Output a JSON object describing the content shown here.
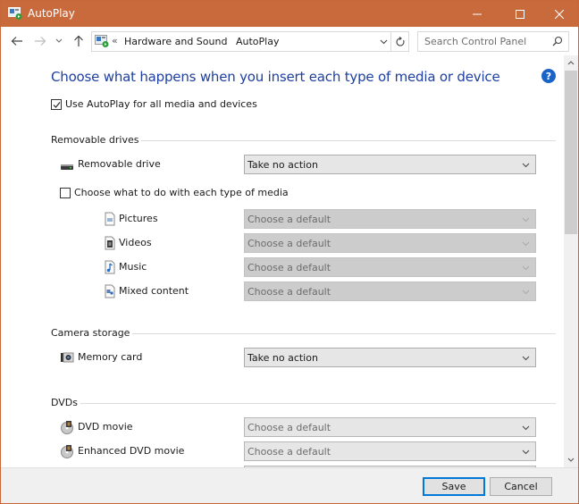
{
  "window": {
    "title": "AutoPlay",
    "accent_color": "#c96a3d"
  },
  "nav": {
    "back_icon": "arrow-left-icon",
    "forward_icon": "arrow-right-icon",
    "recent_icon": "chevron-down-icon",
    "up_icon": "arrow-up-icon",
    "breadcrumb_overflow": "«",
    "breadcrumb": [
      "Hardware and Sound",
      "AutoPlay"
    ],
    "breadcrumb_separator": "›",
    "search_placeholder": "Search Control Panel"
  },
  "main": {
    "heading": "Choose what happens when you insert each type of media or device",
    "help_label": "?",
    "use_autoplay": {
      "label": "Use AutoPlay for all media and devices",
      "checked": true
    },
    "sections": {
      "removable": {
        "title": "Removable drives",
        "drive": {
          "label": "Removable drive",
          "value": "Take no action"
        },
        "per_media": {
          "label": "Choose what to do with each type of media",
          "checked": false
        },
        "media": [
          {
            "label": "Pictures",
            "value": "Choose a default"
          },
          {
            "label": "Videos",
            "value": "Choose a default"
          },
          {
            "label": "Music",
            "value": "Choose a default"
          },
          {
            "label": "Mixed content",
            "value": "Choose a default"
          }
        ]
      },
      "camera": {
        "title": "Camera storage",
        "memory_card": {
          "label": "Memory card",
          "value": "Take no action"
        }
      },
      "dvds": {
        "title": "DVDs",
        "items": [
          {
            "label": "DVD movie",
            "value": "Choose a default"
          },
          {
            "label": "Enhanced DVD movie",
            "value": "Choose a default"
          }
        ]
      }
    }
  },
  "footer": {
    "save_label": "Save",
    "cancel_label": "Cancel"
  }
}
